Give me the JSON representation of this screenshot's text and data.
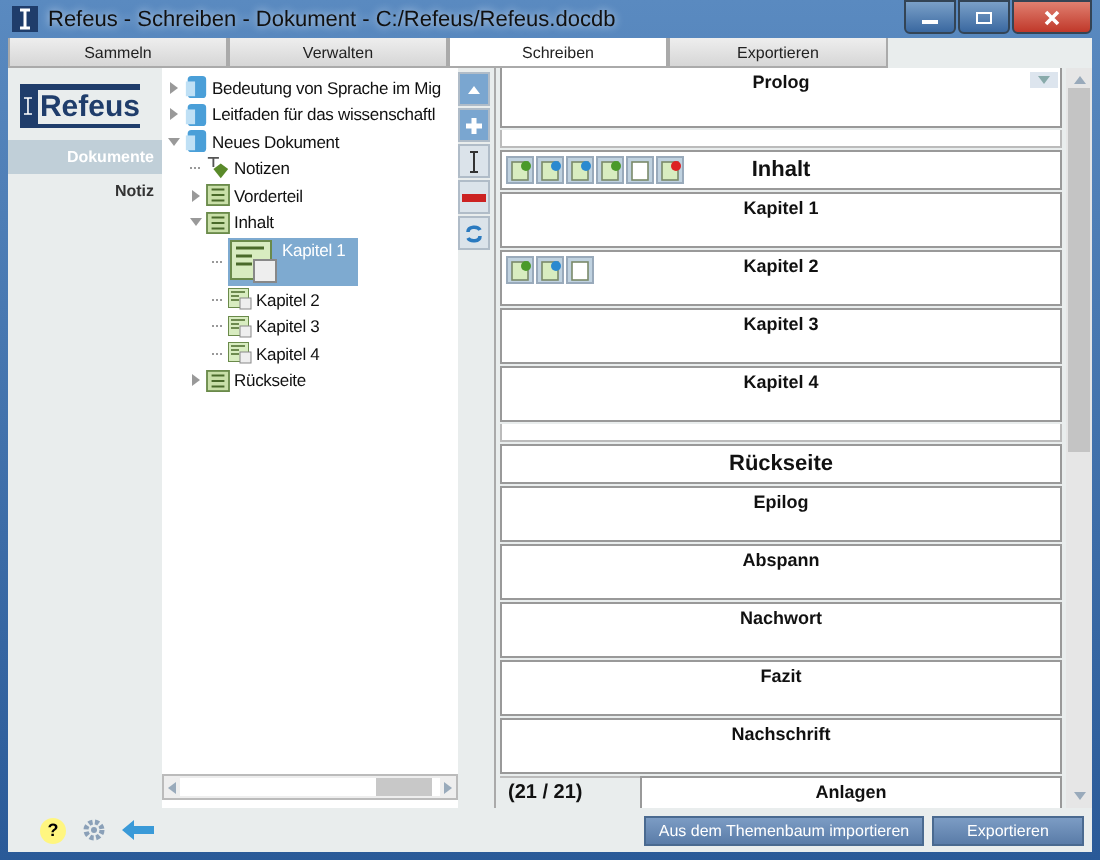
{
  "window": {
    "title": "Refeus - Schreiben - Dokument - C:/Refeus/Refeus.docdb"
  },
  "tabs": [
    {
      "label": "Sammeln",
      "selected": false
    },
    {
      "label": "Verwalten",
      "selected": false
    },
    {
      "label": "Schreiben",
      "selected": true
    },
    {
      "label": "Exportieren",
      "selected": false
    }
  ],
  "logo": {
    "text": "Refeus"
  },
  "sidebar": {
    "items": [
      {
        "label": "Dokumente",
        "selected": true
      },
      {
        "label": "Notiz",
        "selected": false
      }
    ]
  },
  "tree": [
    {
      "label": "Bedeutung von Sprache im Mig",
      "kind": "document",
      "expanded": false,
      "selected": false
    },
    {
      "label": "Leitfaden für das wissenschaftl",
      "kind": "document",
      "expanded": false,
      "selected": false
    },
    {
      "label": "Neues Dokument",
      "kind": "document",
      "expanded": true,
      "selected": false,
      "children": [
        {
          "label": "Notizen",
          "kind": "notes",
          "selected": false
        },
        {
          "label": "Vorderteil",
          "kind": "section",
          "expanded": false,
          "selected": false
        },
        {
          "label": "Inhalt",
          "kind": "section",
          "expanded": true,
          "selected": false,
          "children": [
            {
              "label": "Kapitel 1",
              "kind": "chapter",
              "selected": true
            },
            {
              "label": "Kapitel 2",
              "kind": "chapter",
              "selected": false
            },
            {
              "label": "Kapitel 3",
              "kind": "chapter",
              "selected": false
            },
            {
              "label": "Kapitel 4",
              "kind": "chapter",
              "selected": false
            }
          ]
        },
        {
          "label": "Rückseite",
          "kind": "section",
          "expanded": false,
          "selected": false
        }
      ]
    }
  ],
  "document": {
    "blocks": [
      {
        "label": "Prolog",
        "kind": "item",
        "toolbar": false
      },
      {
        "label": "Inhalt",
        "kind": "header",
        "toolbar": true
      },
      {
        "label": "Kapitel 1",
        "kind": "item",
        "toolbar": false
      },
      {
        "label": "Kapitel 2",
        "kind": "item",
        "toolbar": true
      },
      {
        "label": "Kapitel 3",
        "kind": "item",
        "toolbar": false
      },
      {
        "label": "Kapitel 4",
        "kind": "item",
        "toolbar": false
      },
      {
        "label": "Rückseite",
        "kind": "header",
        "toolbar": false
      },
      {
        "label": "Epilog",
        "kind": "item",
        "toolbar": false
      },
      {
        "label": "Abspann",
        "kind": "item",
        "toolbar": false
      },
      {
        "label": "Nachwort",
        "kind": "item",
        "toolbar": false
      },
      {
        "label": "Fazit",
        "kind": "item",
        "toolbar": false
      },
      {
        "label": "Nachschrift",
        "kind": "item",
        "toolbar": false
      },
      {
        "label": "Anlagen",
        "kind": "item",
        "toolbar": false
      }
    ]
  },
  "page_counter": "(21 / 21)",
  "buttons": [
    {
      "label": "Aus dem Themenbaum importieren"
    },
    {
      "label": "Exportieren"
    }
  ],
  "help_icon": "?"
}
